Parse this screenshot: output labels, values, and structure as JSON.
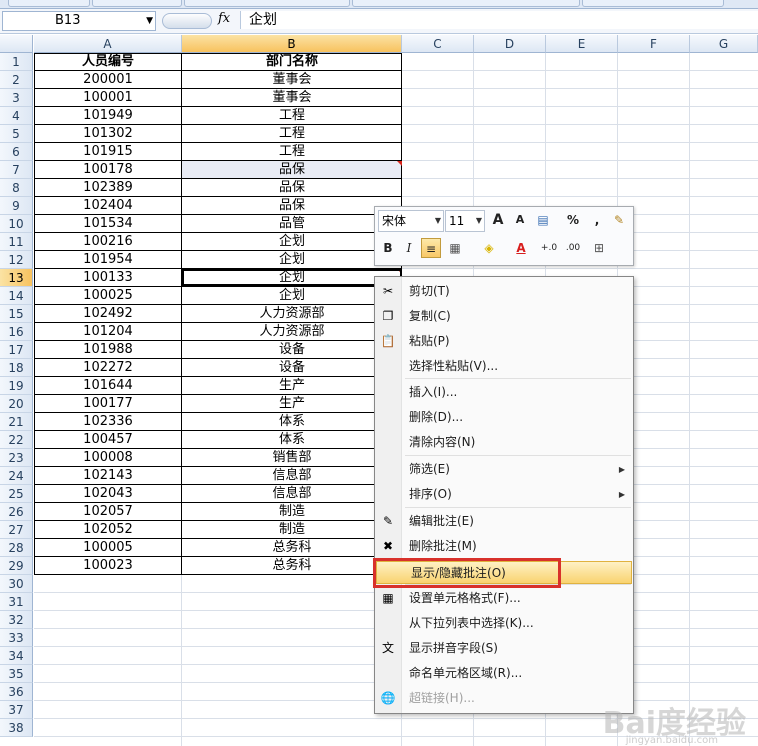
{
  "formula_bar": {
    "name_box": "B13",
    "fx_label": "fx",
    "content": "企划"
  },
  "columns": [
    "A",
    "B",
    "C",
    "D",
    "E",
    "F",
    "G"
  ],
  "rows": [
    "1",
    "2",
    "3",
    "4",
    "5",
    "6",
    "7",
    "8",
    "9",
    "10",
    "11",
    "12",
    "13",
    "14",
    "15",
    "16",
    "17",
    "18",
    "19",
    "20",
    "21",
    "22",
    "23",
    "24",
    "25",
    "26",
    "27",
    "28",
    "29",
    "30",
    "31",
    "32",
    "33",
    "34",
    "35",
    "36",
    "37",
    "38"
  ],
  "table": {
    "headers": [
      "人员编号",
      "部门名称"
    ],
    "data": [
      [
        "200001",
        "董事会"
      ],
      [
        "100001",
        "董事会"
      ],
      [
        "101949",
        "工程"
      ],
      [
        "101302",
        "工程"
      ],
      [
        "101915",
        "工程"
      ],
      [
        "100178",
        "品保"
      ],
      [
        "102389",
        "品保"
      ],
      [
        "102404",
        "品保"
      ],
      [
        "101534",
        "品管"
      ],
      [
        "100216",
        "企划"
      ],
      [
        "101954",
        "企划"
      ],
      [
        "100133",
        "企划"
      ],
      [
        "100025",
        "企划"
      ],
      [
        "102492",
        "人力资源部"
      ],
      [
        "101204",
        "人力资源部"
      ],
      [
        "101988",
        "设备"
      ],
      [
        "102272",
        "设备"
      ],
      [
        "101644",
        "生产"
      ],
      [
        "100177",
        "生产"
      ],
      [
        "102336",
        "体系"
      ],
      [
        "100457",
        "体系"
      ],
      [
        "100008",
        "销售部"
      ],
      [
        "102143",
        "信息部"
      ],
      [
        "102043",
        "信息部"
      ],
      [
        "102057",
        "制造"
      ],
      [
        "102052",
        "制造"
      ],
      [
        "100005",
        "总务科"
      ],
      [
        "100023",
        "总务科"
      ]
    ]
  },
  "mini_toolbar": {
    "font": "宋体",
    "size": "11",
    "grow_font": "A",
    "shrink_font": "A",
    "percent": "%",
    "comma": ",",
    "bold": "B",
    "italic": "I",
    "font_color": "A",
    "inc_decimal": "+.0",
    "dec_decimal": ".00"
  },
  "context_menu": [
    {
      "label": "剪切(T)",
      "icon": "scissors-icon",
      "glyph": "✂"
    },
    {
      "label": "复制(C)",
      "icon": "copy-icon",
      "glyph": "❐"
    },
    {
      "label": "粘贴(P)",
      "icon": "paste-icon",
      "glyph": "📋"
    },
    {
      "label": "选择性粘贴(V)...",
      "icon": "",
      "glyph": ""
    },
    {
      "label": "插入(I)...",
      "icon": "",
      "glyph": ""
    },
    {
      "label": "删除(D)...",
      "icon": "",
      "glyph": ""
    },
    {
      "label": "清除内容(N)",
      "icon": "",
      "glyph": ""
    },
    {
      "label": "筛选(E)",
      "icon": "",
      "glyph": "",
      "submenu": true
    },
    {
      "label": "排序(O)",
      "icon": "",
      "glyph": "",
      "submenu": true
    },
    {
      "label": "编辑批注(E)",
      "icon": "edit-comment-icon",
      "glyph": "✎"
    },
    {
      "label": "删除批注(M)",
      "icon": "delete-comment-icon",
      "glyph": "✖"
    },
    {
      "label": "显示/隐藏批注(O)",
      "icon": "",
      "glyph": "",
      "highlighted": true
    },
    {
      "label": "设置单元格格式(F)...",
      "icon": "format-cells-icon",
      "glyph": "▦"
    },
    {
      "label": "从下拉列表中选择(K)...",
      "icon": "",
      "glyph": ""
    },
    {
      "label": "显示拼音字段(S)",
      "icon": "phonetic-icon",
      "glyph": "文"
    },
    {
      "label": "命名单元格区域(R)...",
      "icon": "",
      "glyph": ""
    },
    {
      "label": "超链接(H)...",
      "icon": "hyperlink-icon",
      "glyph": "🌐",
      "disabled": true
    }
  ],
  "watermark": {
    "text": "Bai度经验",
    "sub": "jingyan.baidu.com"
  }
}
